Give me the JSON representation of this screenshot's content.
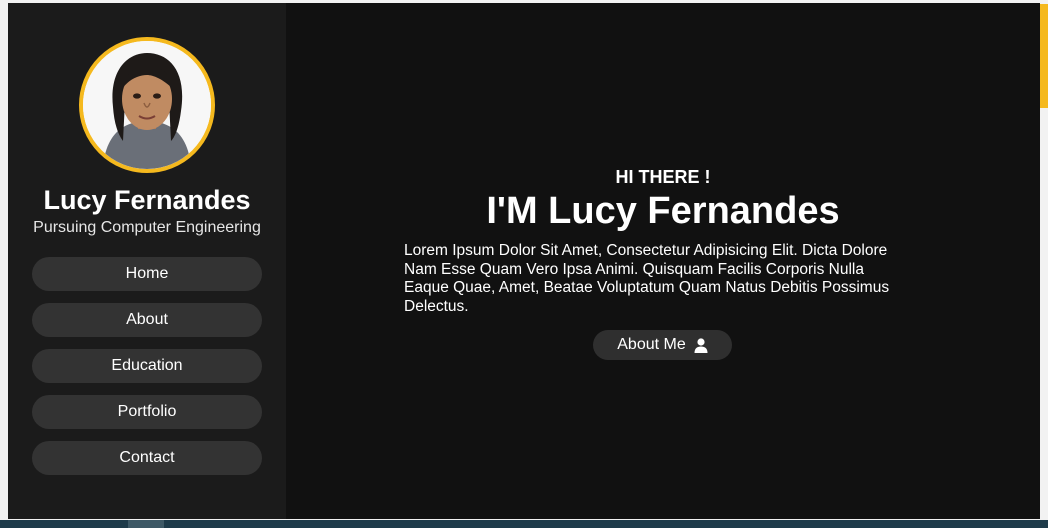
{
  "profile": {
    "name": "Lucy Fernandes",
    "subtitle": "Pursuing Computer Engineering"
  },
  "nav": {
    "items": [
      {
        "label": "Home"
      },
      {
        "label": "About"
      },
      {
        "label": "Education"
      },
      {
        "label": "Portfolio"
      },
      {
        "label": "Contact"
      }
    ]
  },
  "hero": {
    "greeting": "HI THERE !",
    "headline": "I'M Lucy Fernandes",
    "intro": "Lorem Ipsum Dolor Sit Amet, Consectetur Adipisicing Elit. Dicta Dolore Nam Esse Quam Vero Ipsa Animi. Quisquam Facilis Corporis Nulla Eaque Quae, Amet, Beatae Voluptatum Quam Natus Debitis Possimus Delectus.",
    "cta_label": "About Me",
    "cta_icon": "user-icon"
  },
  "colors": {
    "accent": "#f5b91e",
    "sidebar_bg": "#1b1b1b",
    "main_bg": "#111111",
    "button_bg": "#333333"
  }
}
